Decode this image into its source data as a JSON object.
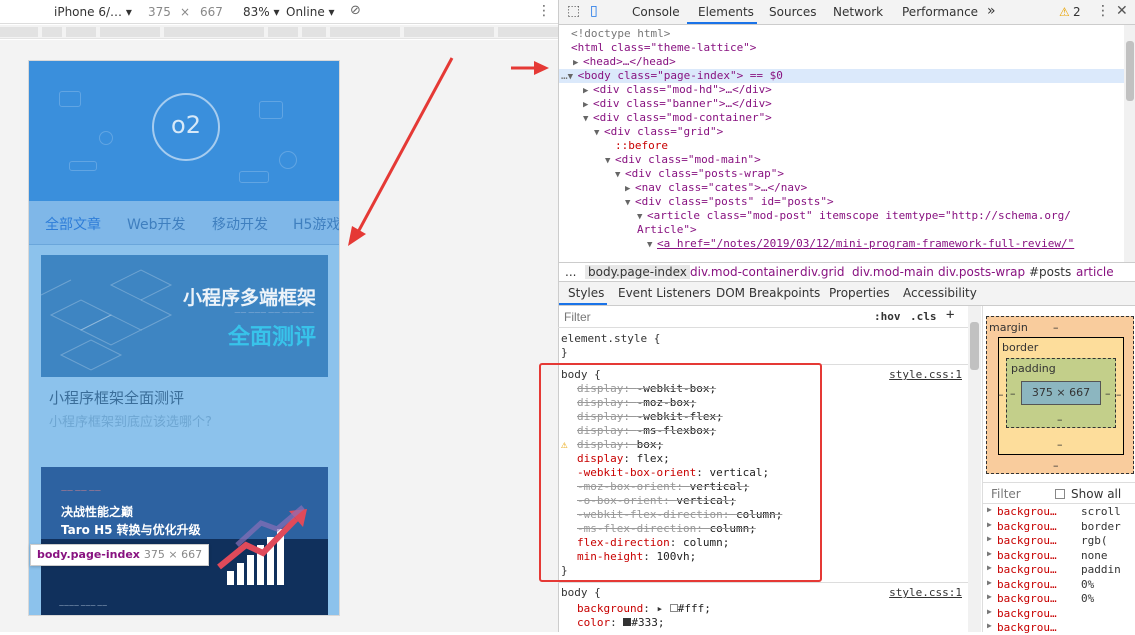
{
  "device_toolbar": {
    "device": "iPhone 6/…",
    "width": "375",
    "times": "×",
    "height": "667",
    "zoom": "83%",
    "network": "Online"
  },
  "phone": {
    "logo": "o2",
    "categories": [
      "全部文章",
      "Web开发",
      "移动开发",
      "H5游戏"
    ],
    "post1": {
      "img_title": "小程序多端框架",
      "img_sub": "全面测评",
      "title": "小程序框架全面测评",
      "subtitle": "小程序框架到底应该选哪个?"
    },
    "post2": {
      "img_line1": "决战性能之巅",
      "img_line2": "Taro H5 转换与优化升级"
    },
    "tooltip": {
      "selector": "body.page-index",
      "size": "375 × 667"
    }
  },
  "devtools": {
    "tabs": [
      "Console",
      "Elements",
      "Sources",
      "Network",
      "Performance"
    ],
    "warning_count": "2",
    "dom_lines": [
      "<!doctype html>",
      "<html class=\"theme-lattice\">",
      "<head>…</head>",
      "<body class=\"page-index\"> == $0",
      "<div class=\"mod-hd\">…</div>",
      "<div class=\"banner\">…</div>",
      "<div class=\"mod-container\">",
      "<div class=\"grid\">",
      "::before",
      "<div class=\"mod-main\">",
      "<div class=\"posts-wrap\">",
      "<nav class=\"cates\">…</nav>",
      "<div class=\"posts\" id=\"posts\">",
      "<article class=\"mod-post\" itemscope itemtype=\"http://schema.org/",
      "Article\">",
      "<a href=\"/notes/2019/03/12/mini-program-framework-full-review/\""
    ],
    "breadcrumbs": [
      "...",
      "body.page-index",
      "div.mod-container",
      "div.grid",
      "div.mod-main",
      "div.posts-wrap",
      "#posts",
      "article"
    ],
    "subtabs": [
      "Styles",
      "Event Listeners",
      "DOM Breakpoints",
      "Properties",
      "Accessibility"
    ],
    "styles_filter": "Filter",
    "hov": ":hov",
    "cls": ".cls",
    "element_style": "element.style {",
    "rule1": {
      "selector": "body {",
      "source": "style.css:1",
      "decls": [
        {
          "p": "display",
          "v": "-webkit-box;",
          "struck": true
        },
        {
          "p": "display",
          "v": "-moz-box;",
          "struck": true
        },
        {
          "p": "display",
          "v": "-webkit-flex;",
          "struck": true
        },
        {
          "p": "display",
          "v": "-ms-flexbox;",
          "struck": true
        },
        {
          "p": "display",
          "v": "box;",
          "struck": true
        },
        {
          "p": "display",
          "v": "flex;",
          "struck": false
        },
        {
          "p": "-webkit-box-orient",
          "v": "vertical;",
          "struck": false
        },
        {
          "p": "-moz-box-orient",
          "v": "vertical;",
          "struck": true
        },
        {
          "p": "-o-box-orient",
          "v": "vertical;",
          "struck": true
        },
        {
          "p": "-webkit-flex-direction",
          "v": "column;",
          "struck": true
        },
        {
          "p": "-ms-flex-direction",
          "v": "column;",
          "struck": true
        },
        {
          "p": "flex-direction",
          "v": "column;",
          "struck": false
        },
        {
          "p": "min-height",
          "v": "100vh;",
          "struck": false
        }
      ]
    },
    "rule2": {
      "selector": "body {",
      "source": "style.css:1",
      "decls": [
        {
          "p": "background",
          "v": "#fff;"
        },
        {
          "p": "color",
          "v": "#333;"
        }
      ]
    },
    "box_model": {
      "margin": "margin",
      "border": "border",
      "padding": "padding",
      "content": "375 × 667",
      "dash": "–"
    },
    "computed": {
      "filter": "Filter",
      "show_all": "Show all",
      "rows": [
        {
          "k": "backgrou…",
          "v": "scroll"
        },
        {
          "k": "backgrou…",
          "v": "border"
        },
        {
          "k": "backgrou…",
          "v": "rgb("
        },
        {
          "k": "backgrou…",
          "v": "none"
        },
        {
          "k": "backgrou…",
          "v": "paddin"
        },
        {
          "k": "backgrou…",
          "v": "0%"
        },
        {
          "k": "backgrou…",
          "v": "0%"
        },
        {
          "k": "backgrou…",
          "v": ""
        },
        {
          "k": "backgrou…",
          "v": ""
        }
      ]
    }
  },
  "colors": {
    "accent": "#1a73e8",
    "arrow": "#e53935",
    "banner": "#3a8fdc"
  }
}
